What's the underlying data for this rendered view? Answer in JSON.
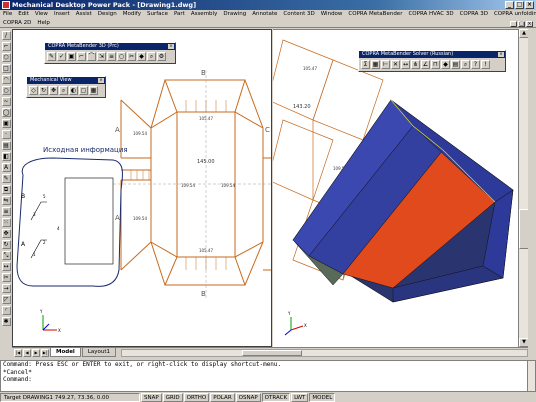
{
  "window": {
    "title": "Mechanical Desktop Power Pack - [Drawing1.dwg]"
  },
  "menu": {
    "row1": [
      "File",
      "Edit",
      "View",
      "Insert",
      "Assist",
      "Design",
      "Modify",
      "Surface",
      "Part",
      "Assembly",
      "Drawing",
      "Annotate",
      "Content 3D",
      "Window",
      "COPRA MetaBender",
      "COPRA HVAC 3D",
      "COPRA 3D",
      "COPRA unfolding"
    ],
    "row2": [
      "COPRA 2D",
      "Help"
    ]
  },
  "palettes": {
    "metabender": {
      "title": "COPRA MetaBender 3D (Prc)"
    },
    "mechview": {
      "title": "Mechanical View"
    },
    "solver": {
      "title": "COPRA MetaBender Solver (Russian)"
    }
  },
  "drawing": {
    "annotation": "Исходная информация",
    "center_value": "145.00",
    "edge_labels": {
      "a": "A",
      "b": "B",
      "c": "C"
    },
    "dim_values": [
      "105.47",
      "109.54",
      "105.47",
      "109.54",
      "109.54",
      "109.54",
      "145.00",
      "143.20",
      "109.54"
    ],
    "sketch_labels": [
      "1",
      "2",
      "3",
      "4",
      "5",
      "6"
    ]
  },
  "tabs": {
    "model": "Model",
    "layout": "Layout1"
  },
  "command": {
    "line1": "Command: Press ESC or ENTER to exit, or right-click to display shortcut-menu.",
    "line2": "*Cancel*",
    "line3": "Command:"
  },
  "status": {
    "coords": "Target DRAWING1  749.27, 73.36, 0.00",
    "toggles": [
      "SNAP",
      "GRID",
      "ORTHO",
      "POLAR",
      "OSNAP",
      "OTRACK",
      "LWT",
      "MODEL"
    ]
  },
  "colors": {
    "titlebar": "#0a246a",
    "part_blue": "#2e3a9a",
    "part_red": "#e04a1c",
    "flat_pattern": "#c86a1c"
  }
}
